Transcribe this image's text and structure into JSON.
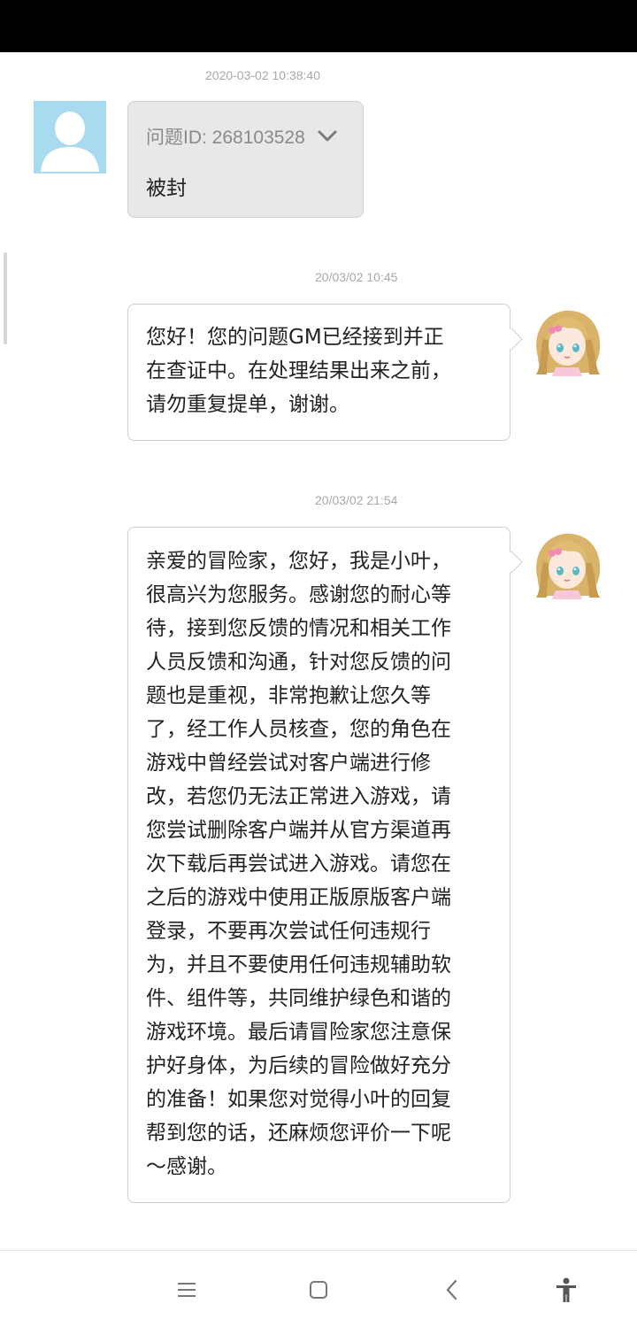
{
  "messages": [
    {
      "timestamp": "2020-03-02 10:38:40",
      "sender": "user",
      "question_id_label": "问题ID: 268103528",
      "text": "被封"
    },
    {
      "timestamp": "20/03/02 10:45",
      "sender": "gm",
      "lines": [
        "您好！您的问题GM已经接到并正",
        "在查证中。在处理结果出来之前，",
        "请勿重复提单，谢谢。"
      ]
    },
    {
      "timestamp": "20/03/02 21:54",
      "sender": "gm",
      "lines": [
        "亲爱的冒险家，您好，我是小叶，",
        "很高兴为您服务。感谢您的耐心等",
        "待，接到您反馈的情况和相关工作",
        "人员反馈和沟通，针对您反馈的问",
        "题也是重视，非常抱歉让您久等",
        "了，经工作人员核查，您的角色在",
        "游戏中曾经尝试对客户端进行修",
        "改，若您仍无法正常进入游戏，请",
        "您尝试删除客户端并从官方渠道再",
        "次下载后再尝试进入游戏。请您在",
        "之后的游戏中使用正版原版客户端",
        "登录，不要再次尝试任何违规行",
        "为，并且不要使用任何违规辅助软",
        "件、组件等，共同维护绿色和谐的",
        "游戏环境。最后请冒险家您注意保",
        "护好身体，为后续的冒险做好充分",
        "的准备！如果您对觉得小叶的回复",
        "帮到您的话，还麻烦您评价一下呢",
        "～感谢。"
      ]
    }
  ],
  "icons": {
    "user_avatar": "default-user-silhouette",
    "gm_avatar": "anime-girl-avatar",
    "expand": "chevron-down-icon",
    "nav_menu": "menu-icon",
    "nav_home": "home-square-icon",
    "nav_back": "back-arrow-icon",
    "nav_accessibility": "accessibility-icon"
  },
  "colors": {
    "user_bubble": "#e8e8e8",
    "gm_bubble": "#ffffff",
    "avatar_bg": "#a8daf0",
    "timestamp_text": "#a8a8a8",
    "status_bar": "#000000"
  }
}
